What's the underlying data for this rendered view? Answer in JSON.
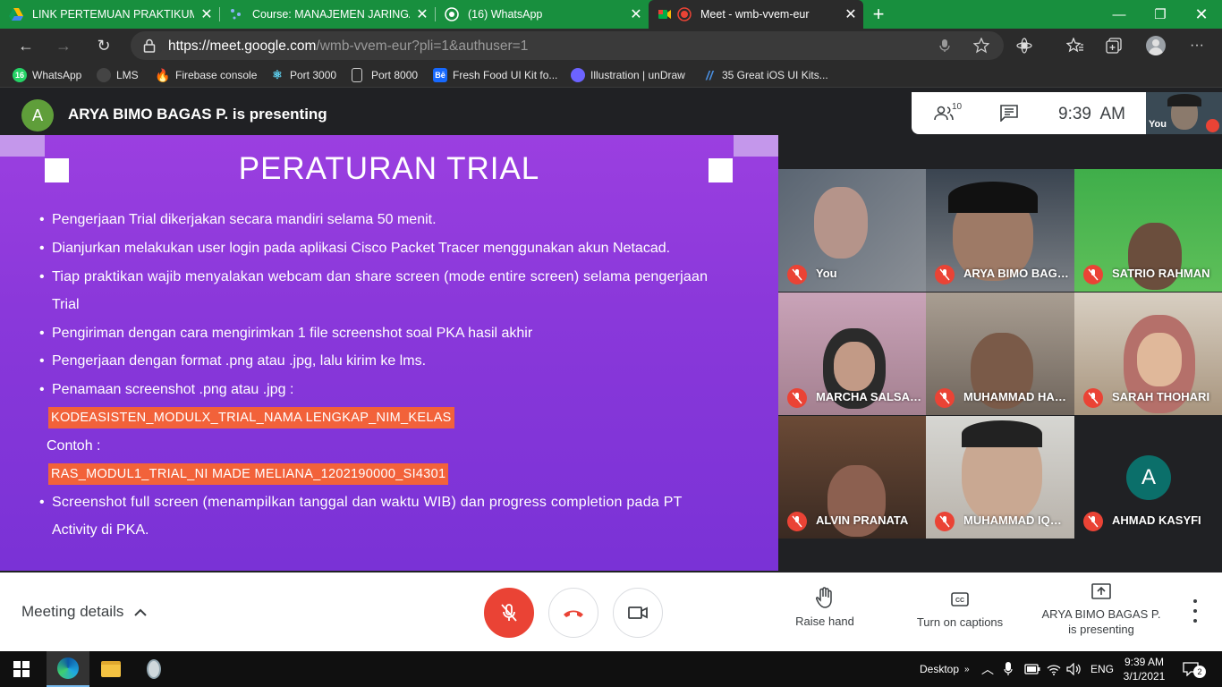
{
  "browser": {
    "tabs": [
      {
        "title": "LINK PERTEMUAN PRAKTIKUM M",
        "icon": "google-drive-icon"
      },
      {
        "title": "Course: MANAJEMEN JARINGAN",
        "icon": "lms-course-icon"
      },
      {
        "title": "(16) WhatsApp",
        "icon": "whatsapp-icon"
      },
      {
        "title": "Meet - wmb-vvem-eur",
        "icon": "google-meet-icon"
      }
    ],
    "new_tab": "+",
    "url_host": "https://meet.google.com",
    "url_path": "/wmb-vvem-eur?pli=1&authuser=1",
    "bookmarks": [
      "WhatsApp",
      "LMS",
      "Firebase console",
      "Port 3000",
      "Port 8000",
      "Fresh Food UI Kit fo...",
      "Illustration | unDraw",
      "35 Great iOS UI Kits..."
    ],
    "bookmark_glyphs": [
      "16",
      "",
      "",
      "",
      "",
      "Bē",
      "",
      ""
    ]
  },
  "meet": {
    "presenter_initial": "A",
    "presenting_text": "ARYA BIMO BAGAS P. is presenting",
    "participant_count": "10",
    "time": "9:39  AM",
    "self_label": "You",
    "slide": {
      "title": "PERATURAN TRIAL",
      "bullets": [
        "Pengerjaan Trial dikerjakan secara mandiri selama 50 menit.",
        "Dianjurkan melakukan user login pada aplikasi Cisco Packet Tracer menggunakan akun Netacad.",
        "Tiap praktikan wajib menyalakan webcam dan share screen (mode entire screen) selama pengerjaan",
        "Trial",
        "Pengiriman dengan cara mengirimkan 1 file screenshot soal PKA hasil akhir",
        "Pengerjaan dengan format .png atau .jpg, lalu kirim ke lms.",
        "Penamaan screenshot .png atau .jpg :",
        "KODEASISTEN_MODULX_TRIAL_NAMA LENGKAP_NIM_KELAS",
        "Contoh :",
        "RAS_MODUL1_TRIAL_NI MADE MELIANA_1202190000_SI4301",
        "Screenshot full screen (menampilkan tanggal dan waktu WIB) dan progress completion pada PT",
        "Activity di PKA."
      ]
    },
    "participants": [
      "You",
      "ARYA BIMO BAGAS P.",
      "SATRIO RAHMAN",
      "MARCHA SALSABILA",
      "MUHAMMAD HAFIZ",
      "SARAH THOHARI",
      "ALVIN PRANATA",
      "MUHAMMAD IQBAL",
      "AHMAD KASYFI"
    ],
    "participant_avatar_initial": "A",
    "controls": {
      "meeting_details": "Meeting details",
      "raise_hand": "Raise hand",
      "captions": "Turn on captions",
      "presenting_line1": "ARYA BIMO BAGAS P.",
      "presenting_line2": "is presenting"
    }
  },
  "taskbar": {
    "desktop": "Desktop",
    "lang": "ENG",
    "time": "9:39 AM",
    "date": "3/1/2021",
    "notif_count": "2"
  },
  "colors": {
    "tabbar": "#188f3e",
    "meet_bg": "#202124",
    "accent_red": "#ea4335",
    "highlight": "#f2623a",
    "slide_purple": "#8a38da"
  }
}
